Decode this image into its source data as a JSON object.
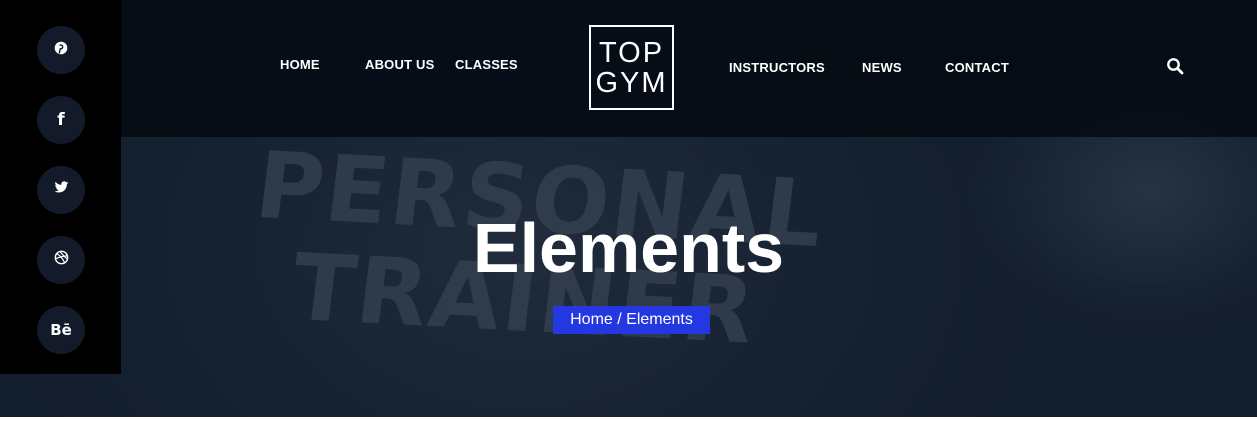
{
  "nav": {
    "home": "HOME",
    "about": "ABOUT US",
    "classes": "CLASSES",
    "instructors": "INSTRUCTORS",
    "news": "NEWS",
    "contact": "CONTACT"
  },
  "logo": {
    "line1": "TOP",
    "line2": "GYM"
  },
  "search": {
    "icon": "search-icon"
  },
  "social": [
    {
      "name": "pinterest",
      "glyph": ""
    },
    {
      "name": "facebook",
      "glyph": "f"
    },
    {
      "name": "twitter",
      "glyph": ""
    },
    {
      "name": "dribbble",
      "glyph": ""
    },
    {
      "name": "behance",
      "glyph": "Bē"
    }
  ],
  "hero": {
    "background_text": "PERSONAL\nTRAINER",
    "title": "Elements",
    "breadcrumb": {
      "home": "Home",
      "separator": " / ",
      "current": "Elements"
    }
  },
  "colors": {
    "breadcrumb_bg": "#2338e0",
    "topbar_bg": "#050a12",
    "sidebar_bg": "#000000",
    "social_btn_bg": "#131b2b"
  }
}
